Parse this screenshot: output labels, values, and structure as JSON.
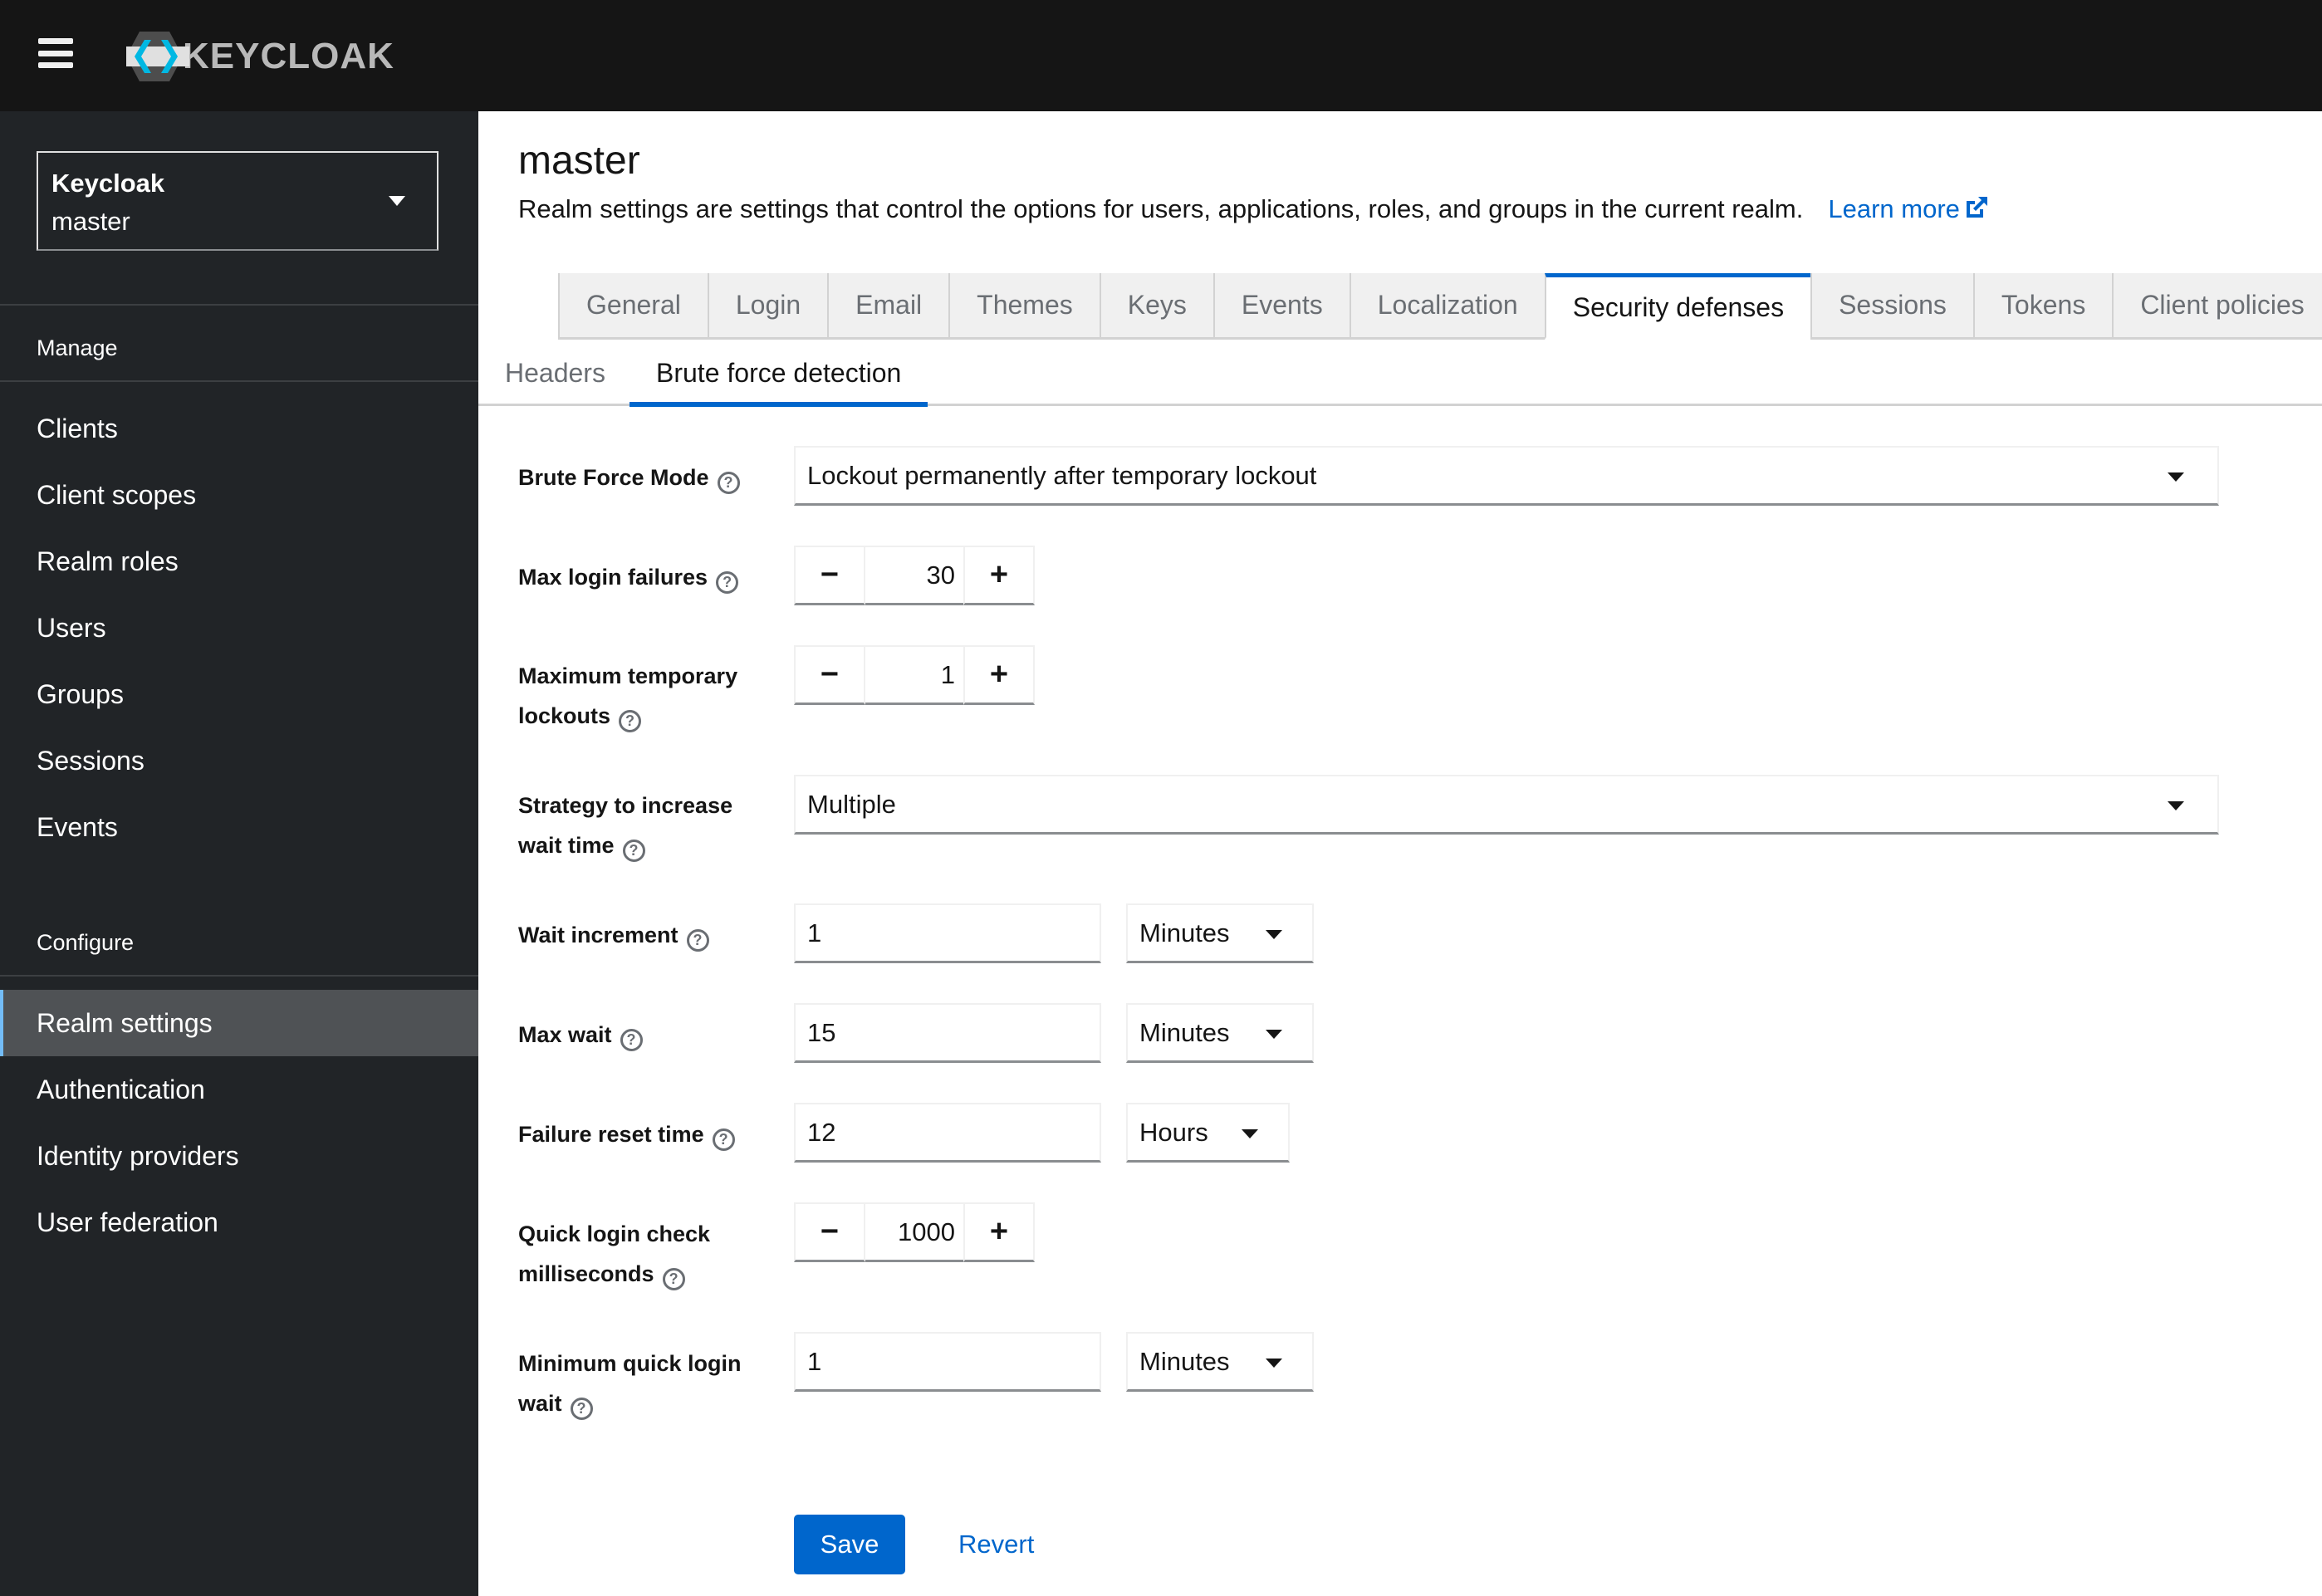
{
  "masthead": {
    "logo_text": "KEYCLOAK",
    "menu_icon": "hamburger-icon"
  },
  "sidebar": {
    "realm_selector": {
      "title": "Keycloak",
      "value": "master"
    },
    "groups": [
      {
        "label": "Manage",
        "items": [
          {
            "label": "Clients"
          },
          {
            "label": "Client scopes"
          },
          {
            "label": "Realm roles"
          },
          {
            "label": "Users"
          },
          {
            "label": "Groups"
          },
          {
            "label": "Sessions"
          },
          {
            "label": "Events"
          }
        ]
      },
      {
        "label": "Configure",
        "items": [
          {
            "label": "Realm settings",
            "active": true
          },
          {
            "label": "Authentication"
          },
          {
            "label": "Identity providers"
          },
          {
            "label": "User federation"
          }
        ]
      }
    ],
    "active_color": "#73bcf7"
  },
  "page": {
    "title": "master",
    "description": "Realm settings are settings that control the options for users, applications, roles, and groups in the current realm.",
    "learn_more": "Learn more"
  },
  "tabs": [
    {
      "label": "General"
    },
    {
      "label": "Login"
    },
    {
      "label": "Email"
    },
    {
      "label": "Themes"
    },
    {
      "label": "Keys"
    },
    {
      "label": "Events"
    },
    {
      "label": "Localization"
    },
    {
      "label": "Security defenses",
      "active": true
    },
    {
      "label": "Sessions"
    },
    {
      "label": "Tokens"
    },
    {
      "label": "Client policies"
    }
  ],
  "subtabs": [
    {
      "label": "Headers"
    },
    {
      "label": "Brute force detection",
      "active": true
    }
  ],
  "form": {
    "brute_force_mode": {
      "label": "Brute Force Mode",
      "value": "Lockout permanently after temporary lockout"
    },
    "max_login_failures": {
      "label": "Max login failures",
      "value": "30"
    },
    "max_temp_lockouts": {
      "label_line1": "Maximum temporary",
      "label_line2": "lockouts",
      "value": "1"
    },
    "strategy": {
      "label_line1": "Strategy to increase",
      "label_line2": "wait time",
      "value": "Multiple"
    },
    "wait_increment": {
      "label": "Wait increment",
      "value": "1",
      "unit": "Minutes"
    },
    "max_wait": {
      "label": "Max wait",
      "value": "15",
      "unit": "Minutes"
    },
    "failure_reset_time": {
      "label": "Failure reset time",
      "value": "12",
      "unit": "Hours"
    },
    "quick_login_check": {
      "label_line1": "Quick login check",
      "label_line2": "milliseconds",
      "value": "1000"
    },
    "min_quick_login_wait": {
      "label_line1": "Minimum quick login",
      "label_line2": "wait",
      "value": "1",
      "unit": "Minutes"
    },
    "help_glyph": "?",
    "minus": "−",
    "plus": "+"
  },
  "actions": {
    "save": "Save",
    "revert": "Revert"
  },
  "colors": {
    "primary": "#0066cc",
    "masthead": "#151515",
    "sidebar": "#212427"
  }
}
